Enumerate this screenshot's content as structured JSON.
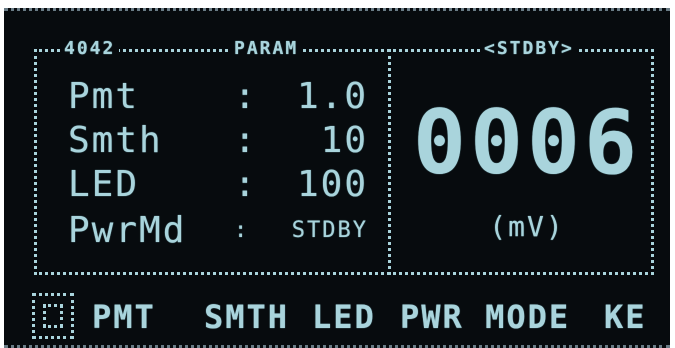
{
  "header": {
    "mode_label": "4042",
    "section_label": "PARAM",
    "state_label": "<STDBY>"
  },
  "params": [
    {
      "label": "Pmt",
      "sep": ":",
      "value": "1.0"
    },
    {
      "label": "Smth",
      "sep": ":",
      "value": "10"
    },
    {
      "label": "LED",
      "sep": ":",
      "value": "100"
    },
    {
      "label": "PwrMd",
      "sep": ":",
      "value": "STDBY"
    }
  ],
  "reading": {
    "value": "0006",
    "unit": "(mV)"
  },
  "softkeys": [
    "PMT",
    "SMTH",
    "LED",
    "PWR MODE",
    "KE"
  ],
  "colors": {
    "background": "#070b0e",
    "pixel": "#a9d4dc"
  },
  "icons": {
    "menu_corner": "corner-box-icon"
  }
}
